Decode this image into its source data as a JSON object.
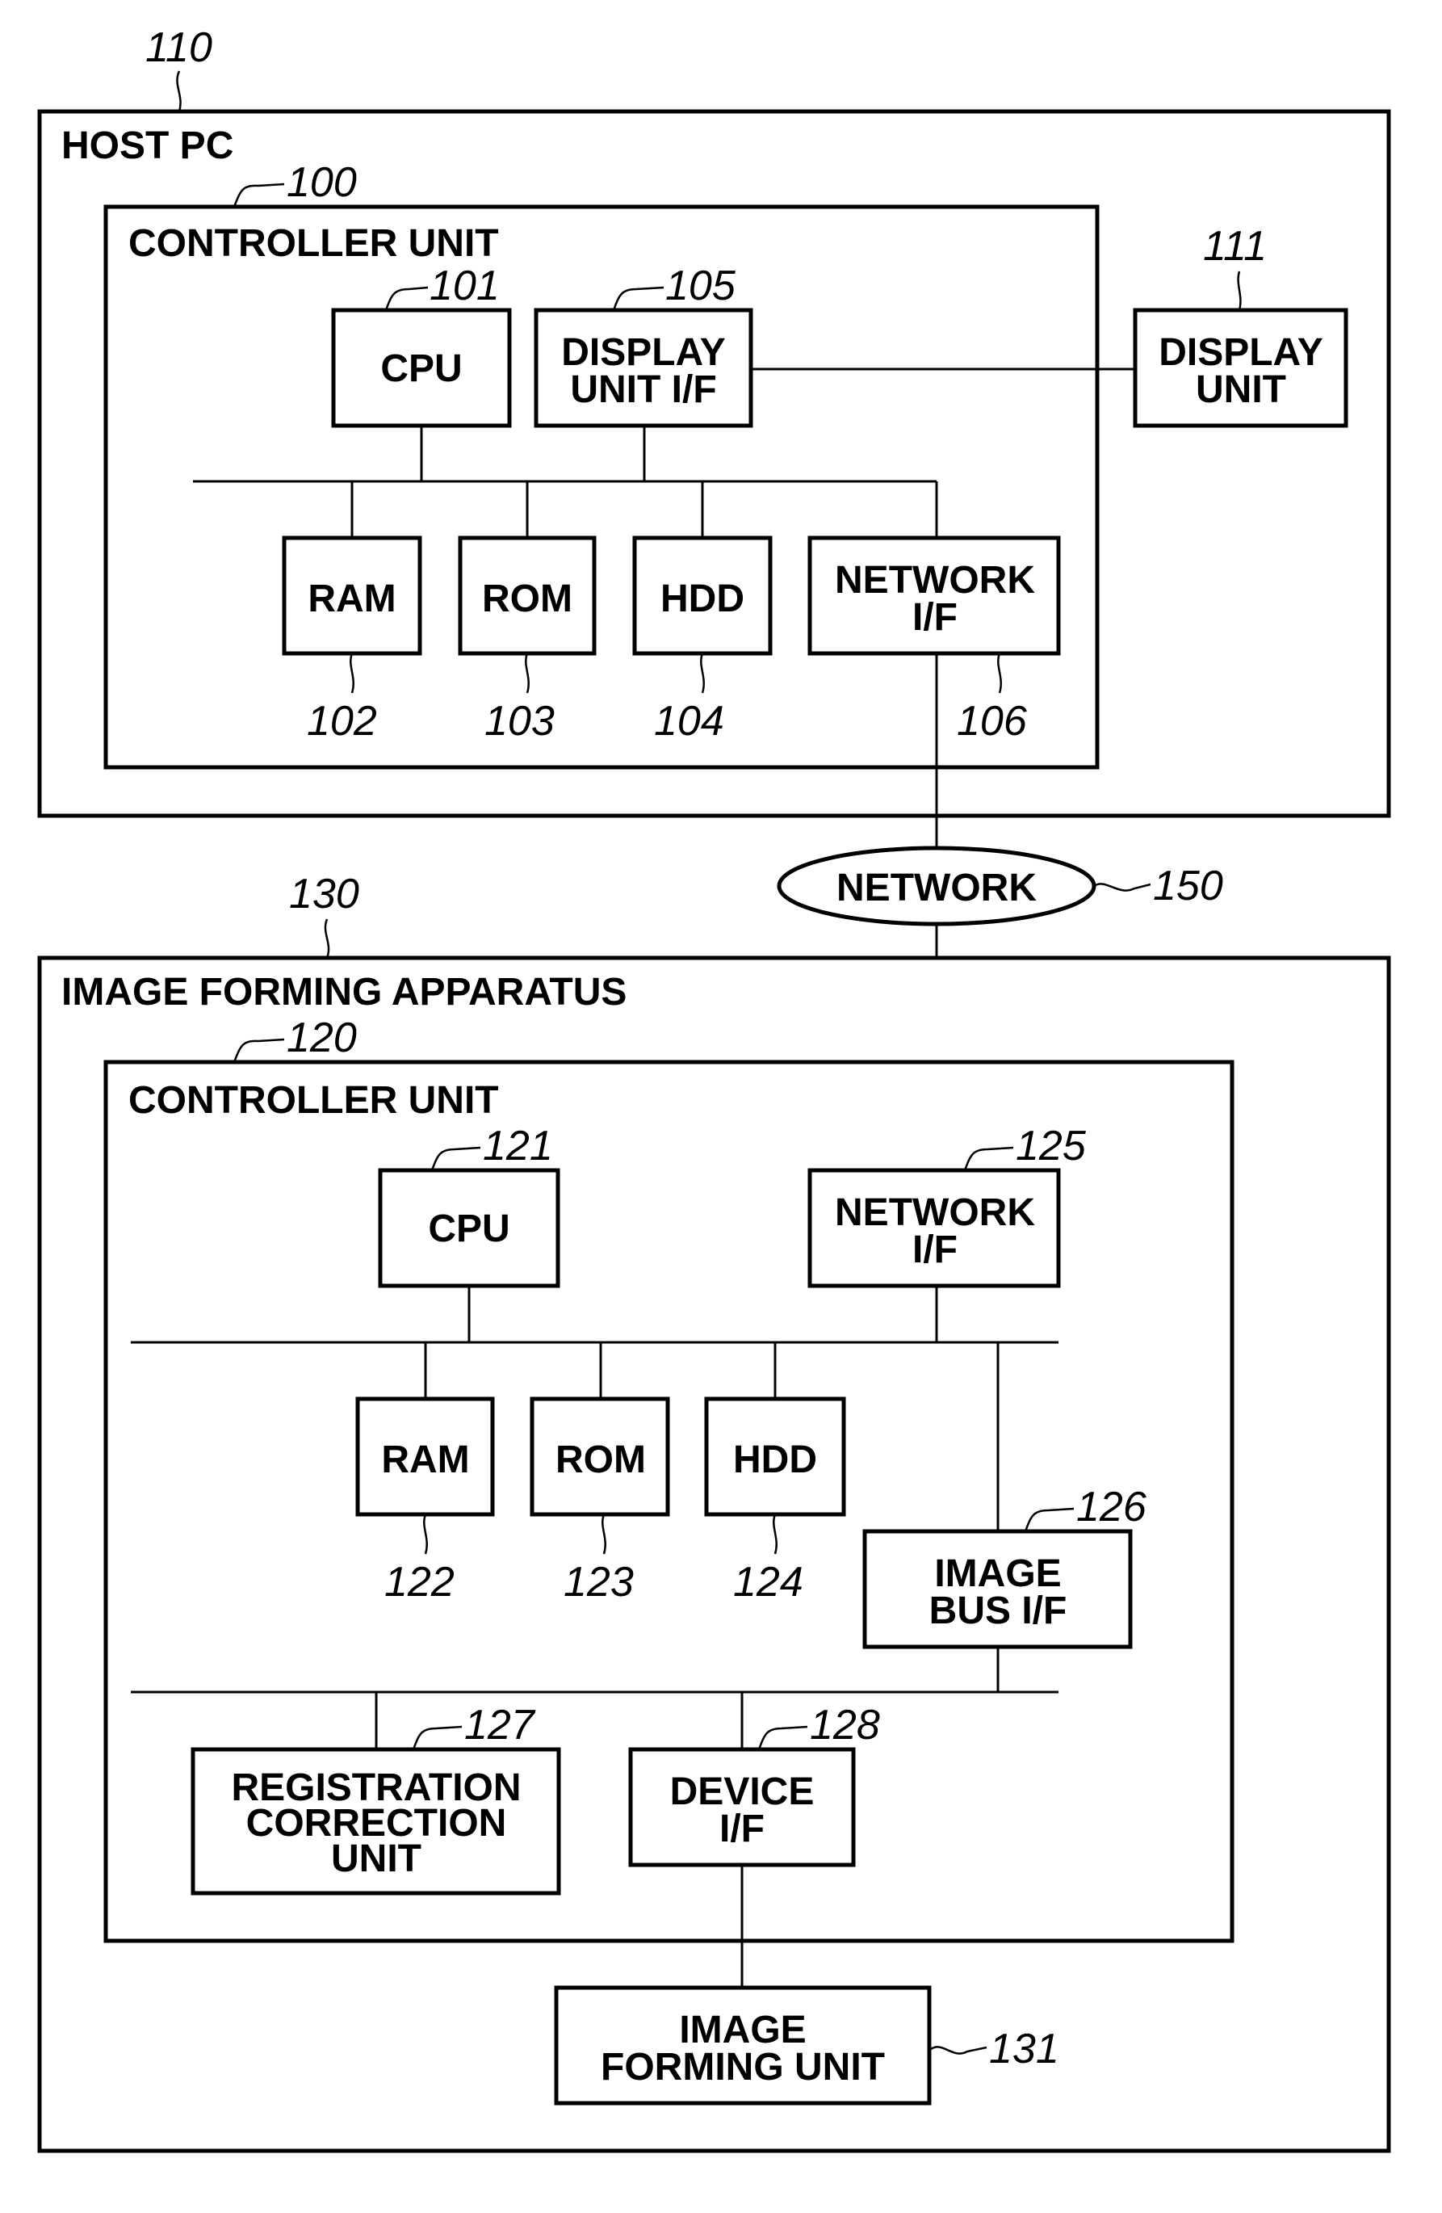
{
  "host_pc": {
    "ref": "110",
    "title": "HOST PC",
    "controller": {
      "ref": "100",
      "title": "CONTROLLER UNIT",
      "cpu": {
        "ref": "101",
        "label": "CPU"
      },
      "display_if": {
        "ref": "105",
        "line1": "DISPLAY",
        "line2": "UNIT I/F"
      },
      "ram": {
        "ref": "102",
        "label": "RAM"
      },
      "rom": {
        "ref": "103",
        "label": "ROM"
      },
      "hdd": {
        "ref": "104",
        "label": "HDD"
      },
      "network_if": {
        "ref": "106",
        "line1": "NETWORK",
        "line2": "I/F"
      }
    },
    "display_unit": {
      "ref": "111",
      "line1": "DISPLAY",
      "line2": "UNIT"
    }
  },
  "network": {
    "ref": "150",
    "label": "NETWORK"
  },
  "image_forming_apparatus": {
    "ref": "130",
    "title": "IMAGE FORMING APPARATUS",
    "controller": {
      "ref": "120",
      "title": "CONTROLLER UNIT",
      "cpu": {
        "ref": "121",
        "label": "CPU"
      },
      "network_if": {
        "ref": "125",
        "line1": "NETWORK",
        "line2": "I/F"
      },
      "ram": {
        "ref": "122",
        "label": "RAM"
      },
      "rom": {
        "ref": "123",
        "label": "ROM"
      },
      "hdd": {
        "ref": "124",
        "label": "HDD"
      },
      "image_bus_if": {
        "ref": "126",
        "line1": "IMAGE",
        "line2": "BUS I/F"
      },
      "registration": {
        "ref": "127",
        "line1": "REGISTRATION",
        "line2": "CORRECTION",
        "line3": "UNIT"
      },
      "device_if": {
        "ref": "128",
        "line1": "DEVICE",
        "line2": "I/F"
      }
    },
    "image_forming_unit": {
      "ref": "131",
      "line1": "IMAGE",
      "line2": "FORMING UNIT"
    }
  }
}
